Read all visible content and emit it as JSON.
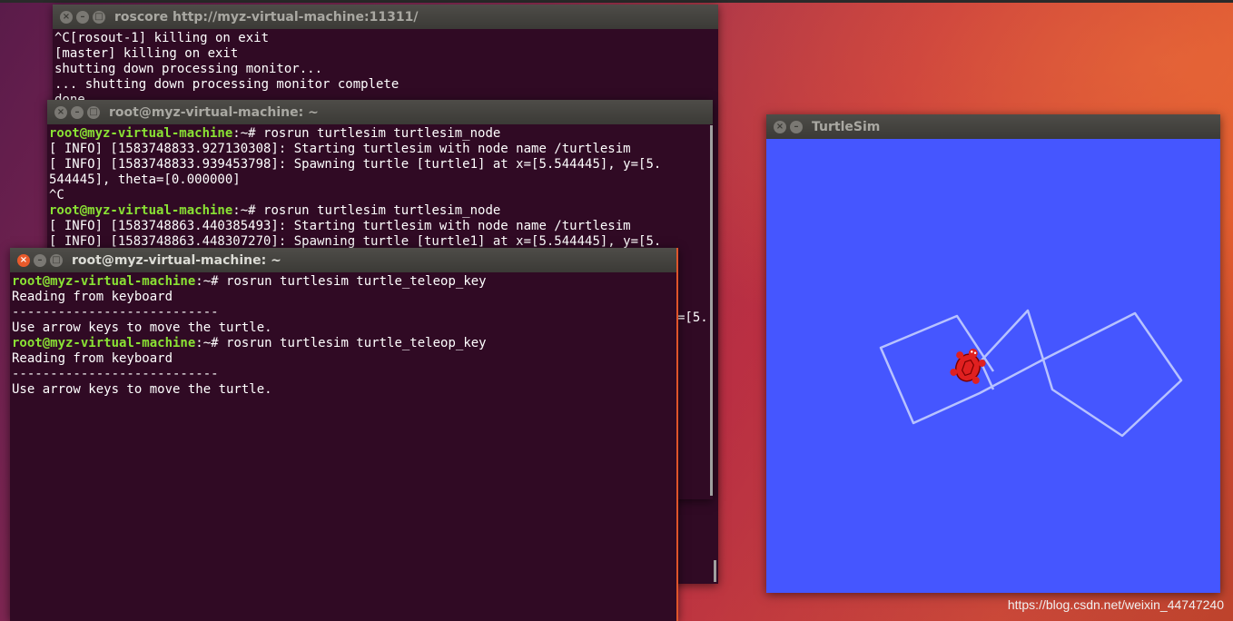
{
  "desktop": {
    "watermark": "https://blog.csdn.net/weixin_44747240"
  },
  "windows": {
    "roscore": {
      "title": "roscore http://myz-virtual-machine:11311/",
      "lines": [
        "^C[rosout-1] killing on exit",
        "[master] killing on exit",
        "shutting down processing monitor...",
        "... shutting down processing monitor complete",
        "done"
      ]
    },
    "node": {
      "title": "root@myz-virtual-machine: ~",
      "prompt_user": "root@myz-virtual-machine",
      "prompt_path": ":~#",
      "cmd1": " rosrun turtlesim turtlesim_node",
      "lines_a": [
        "[ INFO] [1583748833.927130308]: Starting turtlesim with node name /turtlesim",
        "[ INFO] [1583748833.939453798]: Spawning turtle [turtle1] at x=[5.544445], y=[5.",
        "544445], theta=[0.000000]",
        "^C"
      ],
      "cmd2": " rosrun turtlesim turtlesim_node",
      "lines_b": [
        "[ INFO] [1583748863.440385493]: Starting turtlesim with node name /turtlesim",
        "[ INFO] [1583748863.448307270]: Spawning turtle [turtle1] at x=[5.544445], y=[5."
      ],
      "hidden_tail": "=[5."
    },
    "teleop": {
      "title": "root@myz-virtual-machine: ~",
      "prompt_user": "root@myz-virtual-machine",
      "prompt_path": ":~#",
      "cmd": " rosrun turtlesim turtle_teleop_key",
      "line_reading": "Reading from keyboard",
      "line_sep": "---------------------------",
      "line_use": "Use arrow keys to move the turtle."
    },
    "turtlesim": {
      "title": "TurtleSim",
      "background": "#4556ff",
      "trail_color": "#b7c2ff",
      "turtle_color": "#e02020"
    }
  }
}
